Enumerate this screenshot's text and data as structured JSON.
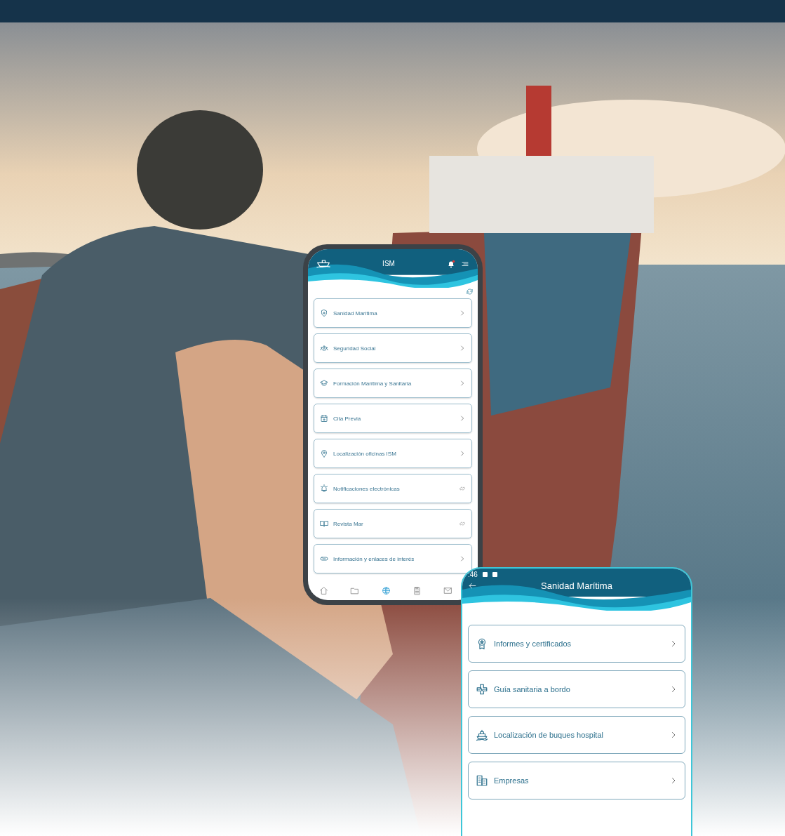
{
  "phone_app": {
    "title": "ISM",
    "notification_dot": true,
    "menu": [
      {
        "label": "Sanidad Marítima",
        "kind": "section"
      },
      {
        "label": "Seguridad Social",
        "kind": "section"
      },
      {
        "label": "Formación Marítima y Sanitaria",
        "kind": "section"
      },
      {
        "label": "Cita Previa",
        "kind": "section"
      },
      {
        "label": "Localización oficinas ISM",
        "kind": "section"
      },
      {
        "label": "Notificaciones electrónicas",
        "kind": "external"
      },
      {
        "label": "Revista Mar",
        "kind": "external"
      },
      {
        "label": "Información y enlaces de interés",
        "kind": "section"
      }
    ],
    "nav": [
      {
        "selected": false
      },
      {
        "selected": false
      },
      {
        "selected": true
      },
      {
        "selected": false
      },
      {
        "selected": false
      }
    ]
  },
  "detail_screen": {
    "status_time": ":46",
    "title": "Sanidad Marítima",
    "items": [
      {
        "label": "Informes y certificados"
      },
      {
        "label": "Guía sanitaria a bordo"
      },
      {
        "label": "Localización de buques hospital"
      },
      {
        "label": "Empresas"
      }
    ]
  }
}
